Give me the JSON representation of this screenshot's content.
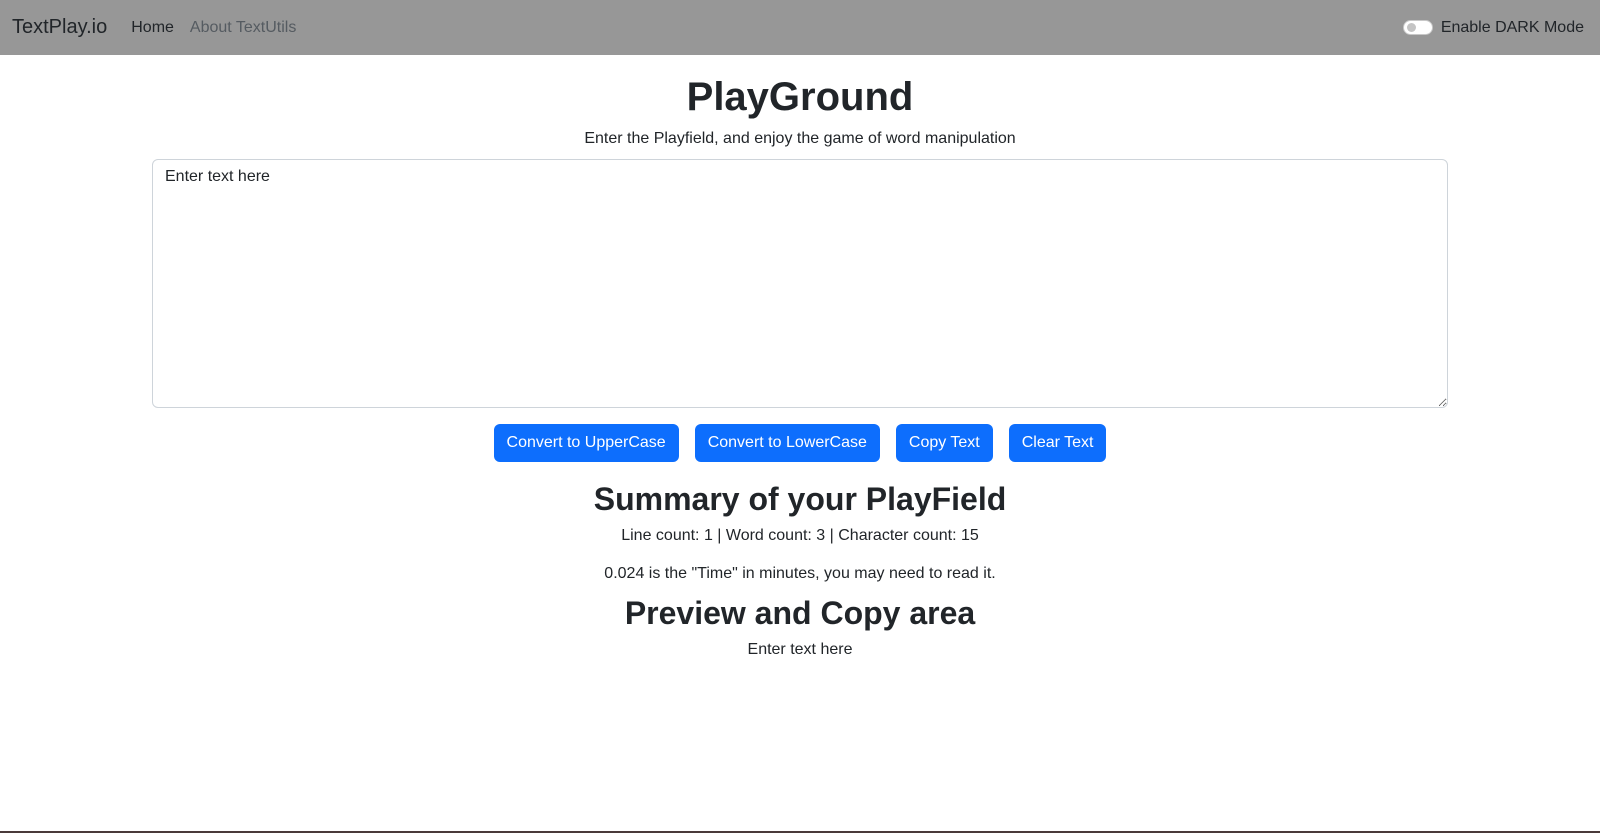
{
  "navbar": {
    "brand": "TextPlay.io",
    "links": [
      {
        "label": "Home"
      },
      {
        "label": "About TextUtils"
      }
    ],
    "dark_mode_label": "Enable DARK Mode"
  },
  "main": {
    "title": "PlayGround",
    "subtitle": "Enter the Playfield, and enjoy the game of word manipulation",
    "textarea_placeholder": "Enter text here",
    "buttons": {
      "uppercase": "Convert to UpperCase",
      "lowercase": "Convert to LowerCase",
      "copy": "Copy Text",
      "clear": "Clear Text"
    }
  },
  "summary": {
    "title": "Summary of your PlayField",
    "counts": "Line count: 1 | Word count: 3 | Character count: 15",
    "time": "0.024 is the \"Time\" in minutes, you may need to read it."
  },
  "preview": {
    "title": "Preview and Copy area",
    "text": "Enter text here"
  },
  "colors": {
    "navbar_bg": "#979797",
    "button_primary": "#0d6efd"
  },
  "icons": {
    "dark_mode_toggle": "toggle-switch-icon"
  }
}
